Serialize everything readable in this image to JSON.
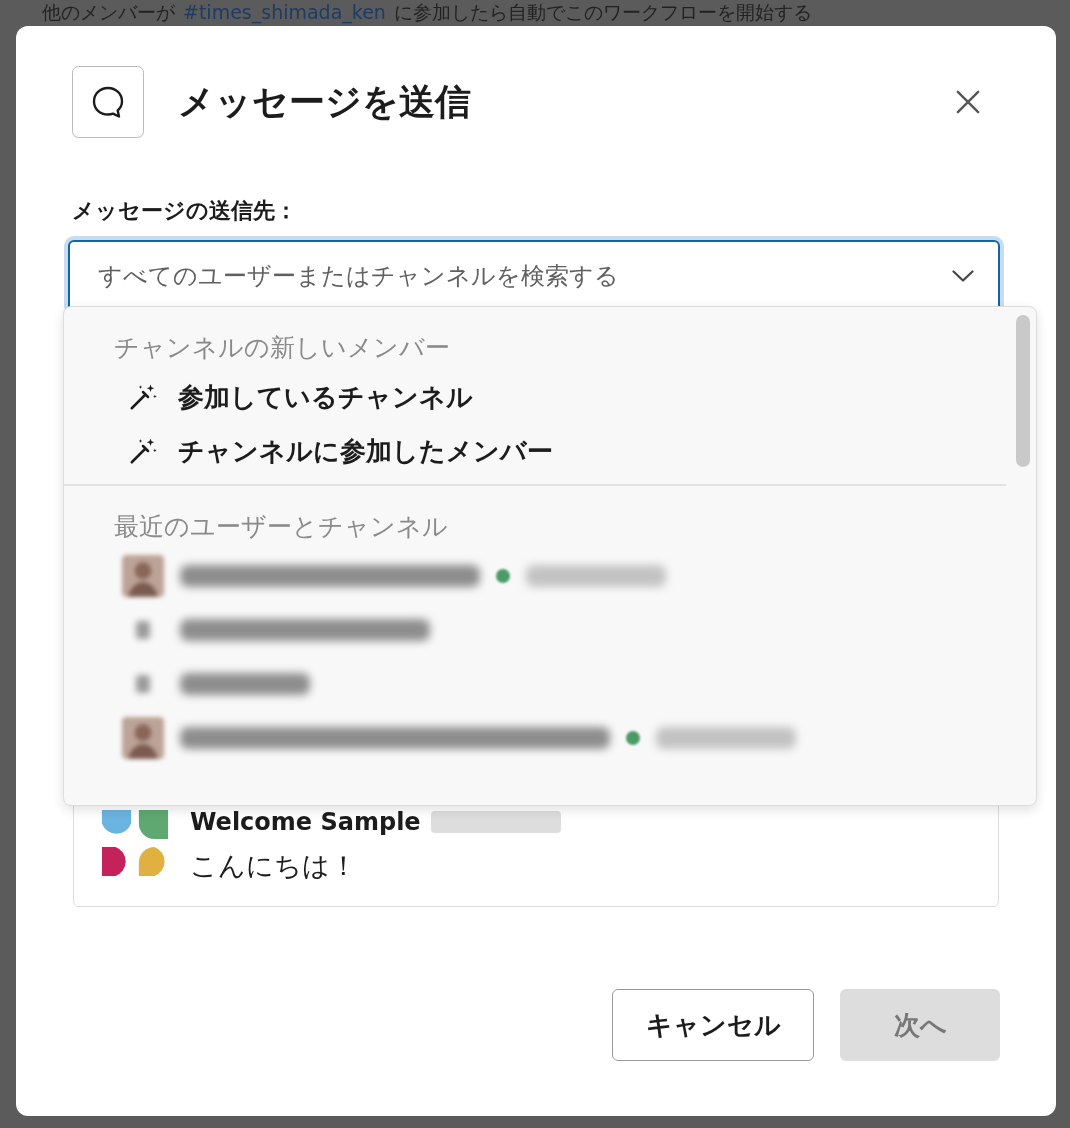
{
  "background": {
    "text_before": "他のメンバーが",
    "channel_link": "#times_shimada_ken",
    "text_after": "に参加したら自動でこのワークフローを開始する"
  },
  "dialog": {
    "title": "メッセージを送信",
    "field_label": "メッセージの送信先：",
    "search": {
      "placeholder": "すべてのユーザーまたはチャンネルを検索する",
      "focused": true
    },
    "dropdown": {
      "sections": [
        {
          "heading": "チャンネルの新しいメンバー",
          "items": [
            {
              "kind": "special",
              "label": "参加しているチャンネル"
            },
            {
              "kind": "special",
              "label": "チャンネルに参加したメンバー"
            }
          ]
        },
        {
          "heading": "最近のユーザーとチャンネル",
          "items": [
            {
              "kind": "user",
              "online": true
            },
            {
              "kind": "channel"
            },
            {
              "kind": "channel"
            },
            {
              "kind": "user",
              "online": true
            }
          ]
        }
      ]
    },
    "preview": {
      "sender": "Welcome Sample",
      "message": "こんにちは！"
    },
    "buttons": [
      {
        "label": "キャンセル",
        "kind": "secondary",
        "disabled": false
      },
      {
        "label": "次へ",
        "kind": "primary",
        "disabled": true
      }
    ]
  }
}
